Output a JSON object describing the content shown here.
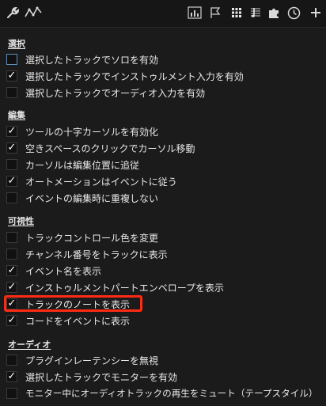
{
  "toolbar": {
    "left_icons": [
      "wrench-icon",
      "curve-icon"
    ],
    "right_icons": [
      "bar-chart-icon",
      "flag-icon",
      "grid-icon",
      "score-icon",
      "puzzle-icon",
      "clock-icon",
      "plus-icon"
    ]
  },
  "sections": [
    {
      "title": "選択",
      "items": [
        {
          "label": "選択したトラックでソロを有効",
          "checked": false,
          "focused": true
        },
        {
          "label": "選択したトラックでインストゥルメント入力を有効",
          "checked": true
        },
        {
          "label": "選択したトラックでオーディオ入力を有効",
          "checked": false
        }
      ]
    },
    {
      "title": "編集",
      "items": [
        {
          "label": "ツールの十字カーソルを有効化",
          "checked": true
        },
        {
          "label": "空きスペースのクリックでカーソル移動",
          "checked": true
        },
        {
          "label": "カーソルは編集位置に追従",
          "checked": false
        },
        {
          "label": "オートメーションはイベントに従う",
          "checked": true
        },
        {
          "label": "イベントの編集時に重複しない",
          "checked": false
        }
      ]
    },
    {
      "title": "可視性",
      "items": [
        {
          "label": "トラックコントロール色を変更",
          "checked": false
        },
        {
          "label": "チャンネル番号をトラックに表示",
          "checked": false
        },
        {
          "label": "イベント名を表示",
          "checked": true
        },
        {
          "label": "インストゥルメントパートエンベロープを表示",
          "checked": true
        },
        {
          "label": "トラックのノートを表示",
          "checked": true,
          "highlighted": true
        },
        {
          "label": "コードをイベントに表示",
          "checked": true
        }
      ]
    },
    {
      "title": "オーディオ",
      "items": [
        {
          "label": "プラグインレーテンシーを無視",
          "checked": false
        },
        {
          "label": "選択したトラックでモニターを有効",
          "checked": true
        },
        {
          "label": "モニター中にオーディオトラックの再生をミュート（テープスタイル）",
          "checked": false
        }
      ]
    }
  ],
  "colors": {
    "background": "#1b1b1b",
    "highlight": "#ff2a14",
    "focus_border": "#5f8fb6"
  }
}
